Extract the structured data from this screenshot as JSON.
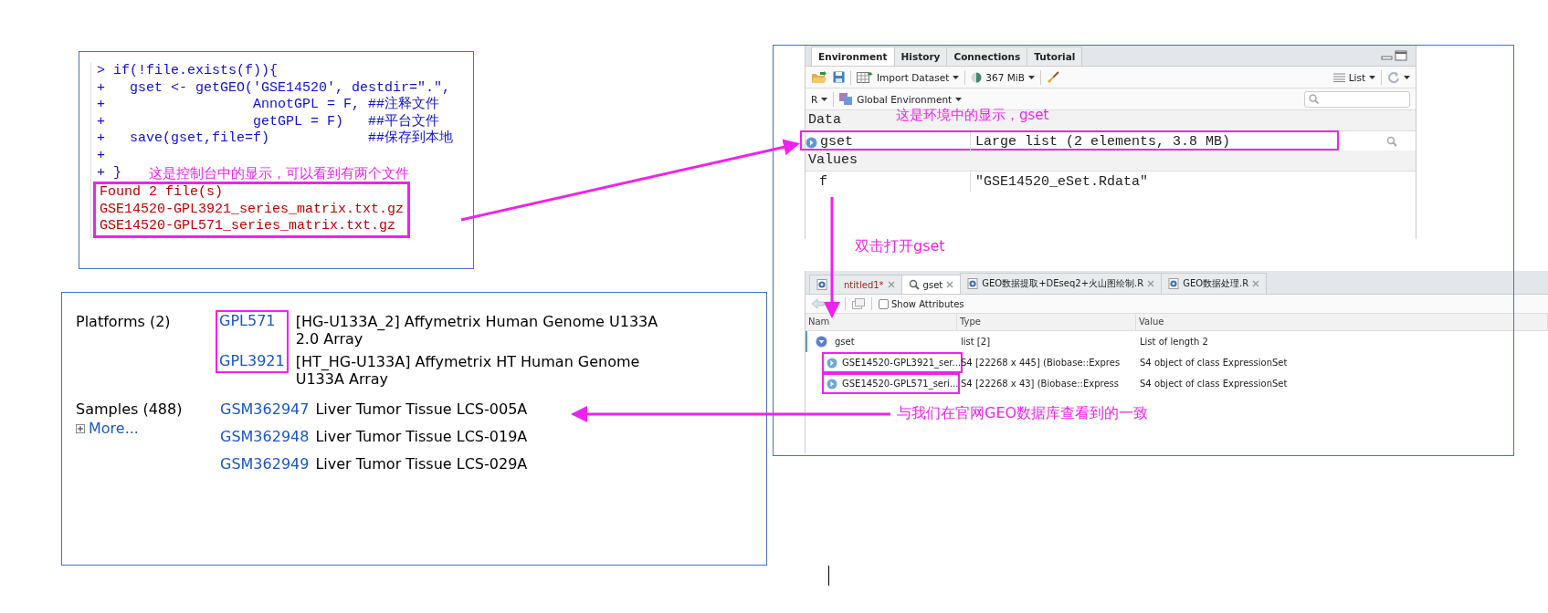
{
  "console": {
    "lines": [
      {
        "prompt": ">",
        "code": "if(!file.exists(f)){"
      },
      {
        "prompt": "+",
        "code": "  gset <- getGEO('GSE14520', destdir=\".\","
      },
      {
        "prompt": "+",
        "code": "                 AnnotGPL = F, ##注释文件"
      },
      {
        "prompt": "+",
        "code": "                 getGPL = F)   ##平台文件"
      },
      {
        "prompt": "+",
        "code": "  save(gset,file=f)            ##保存到本地"
      },
      {
        "prompt": "+"
      },
      {
        "prompt": "+",
        "code": "}"
      }
    ],
    "annotation": "这是控制台中的显示，可以看到有两个文件",
    "output": {
      "highlighted": true,
      "lines": [
        "Found 2 file(s)",
        "GSE14520-GPL3921_series_matrix.txt.gz",
        "GSE14520-GPL571_series_matrix.txt.gz"
      ]
    }
  },
  "environment": {
    "tabs": [
      {
        "label": "Environment",
        "selected": true
      },
      {
        "label": "History",
        "selected": false
      },
      {
        "label": "Connections",
        "selected": false
      },
      {
        "label": "Tutorial",
        "selected": false
      }
    ],
    "toolbar": {
      "import": "Import Dataset",
      "memory": "367 MiB",
      "view": "List"
    },
    "scope": {
      "language": "R",
      "environment": "Global Environment"
    },
    "annotation": "这是环境中的显示，gset",
    "sections": [
      {
        "title": "Data",
        "rows": [
          {
            "name": "gset",
            "value": "Large list (2 elements,  3.8 MB)",
            "highlighted": true,
            "kind": "data"
          }
        ]
      },
      {
        "title": "Values",
        "rows": [
          {
            "name": "f",
            "value": "\"GSE14520_eSet.Rdata\"",
            "highlighted": false,
            "kind": "value"
          }
        ]
      }
    ]
  },
  "viewer": {
    "tabs": [
      {
        "label": "ntitled1*",
        "selected": false,
        "kind": "script",
        "unsaved": true
      },
      {
        "label": "gset",
        "selected": true,
        "kind": "view",
        "unsaved": false
      },
      {
        "label": "GEO数据提取+DEseq2+火山图绘制.R",
        "selected": false,
        "kind": "script",
        "unsaved": false
      },
      {
        "label": "GEO数据处理.R",
        "selected": false,
        "kind": "script",
        "unsaved": false
      }
    ],
    "show_attributes": {
      "label": "Show Attributes",
      "checked": false
    },
    "columns": [
      "Nam",
      "Type",
      "Value"
    ],
    "rows": [
      {
        "name": "gset",
        "type": "list [2]",
        "value": "List of length 2",
        "expanded": true,
        "children": [
          {
            "name": "GSE14520-GPL3921_ser...",
            "type": "S4 [22268 x 445] (Biobase::Expres",
            "value": "S4 object of class ExpressionSet",
            "highlighted": true
          },
          {
            "name": "GSE14520-GPL571_seri...",
            "type": "S4 [22268 x 43] (Biobase::Express",
            "value": "S4 object of class ExpressionSet",
            "highlighted": true
          }
        ]
      }
    ]
  },
  "geo": {
    "platforms": {
      "label": "Platforms (2)",
      "items": [
        {
          "id": "GPL571",
          "description": "[HG-U133A_2] Affymetrix Human Genome U133A 2.0 Array"
        },
        {
          "id": "GPL3921",
          "description": "[HT_HG-U133A] Affymetrix HT Human Genome U133A Array"
        }
      ],
      "ids_highlighted": true
    },
    "samples": {
      "label": "Samples (488)",
      "more": "More...",
      "items": [
        {
          "id": "GSM362947",
          "description": "Liver Tumor Tissue LCS-005A"
        },
        {
          "id": "GSM362948",
          "description": "Liver Tumor Tissue LCS-019A"
        },
        {
          "id": "GSM362949",
          "description": "Liver Tumor Tissue LCS-029A"
        }
      ]
    }
  },
  "notes": [
    "双击打开gset",
    "与我们在官网GEO数据库查看到的一致"
  ]
}
